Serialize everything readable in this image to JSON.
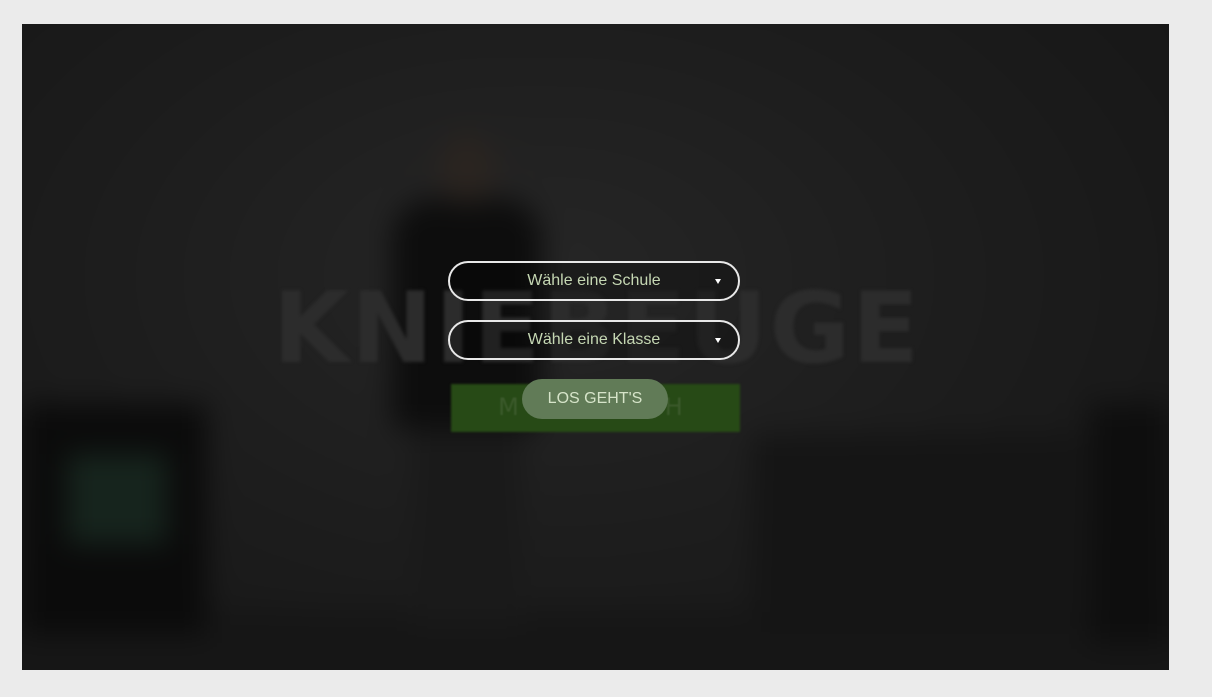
{
  "background": {
    "title": "KNIEBEUGE",
    "subtitle": "MIT TECH"
  },
  "form": {
    "school_select": {
      "placeholder": "Wähle eine Schule"
    },
    "class_select": {
      "placeholder": "Wähle eine Klasse"
    },
    "submit_label": "LOS GEHT'S"
  },
  "colors": {
    "page_background": "#ebebeb",
    "overlay": "#1b1b1b",
    "accent_green": "#617b57",
    "label_text": "#c5d7b3",
    "pill_border": "#e8e8e8"
  },
  "icons": {
    "dropdown": "caret-down-icon"
  }
}
